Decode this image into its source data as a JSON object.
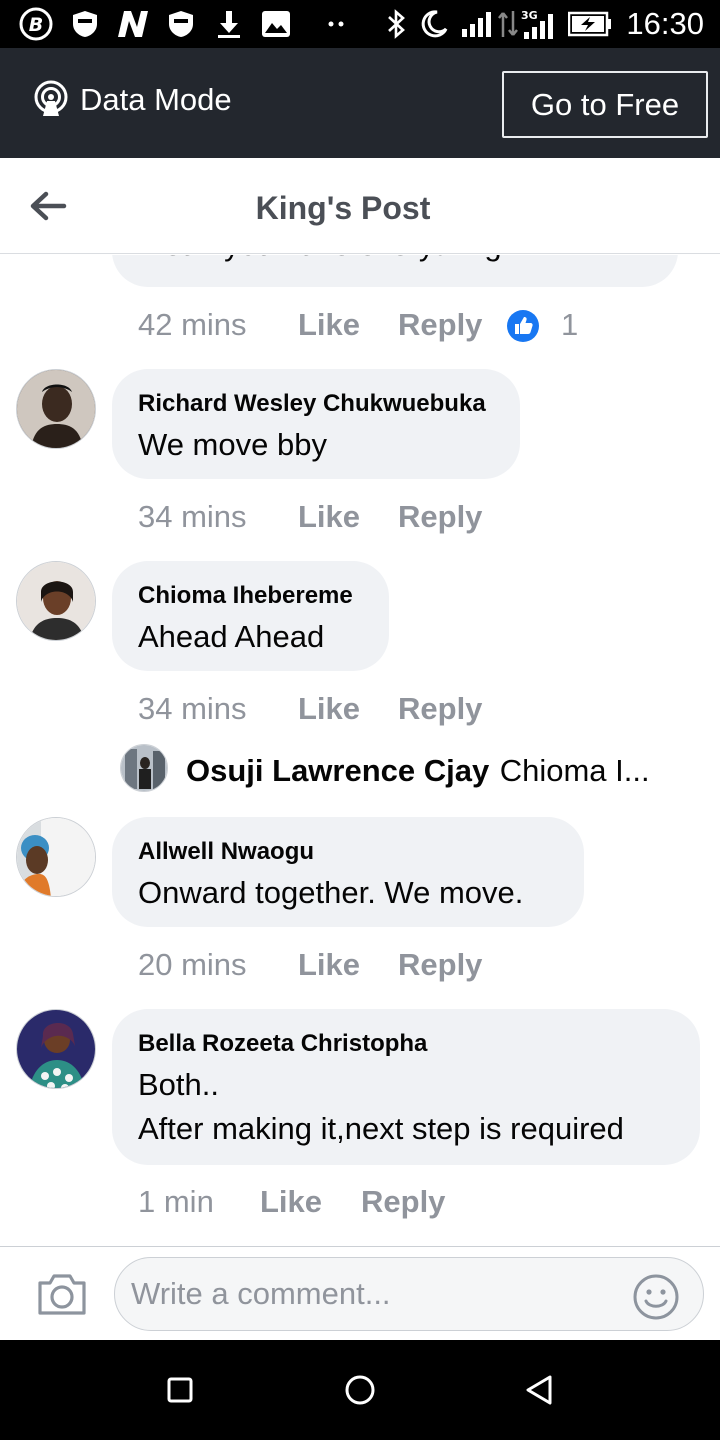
{
  "status_bar": {
    "time": "16:30",
    "network": "3G",
    "icons": [
      "b-app-icon",
      "shield-icon",
      "n-app-icon",
      "shield-icon",
      "download-icon",
      "image-icon",
      "dots-icon",
      "bluetooth-icon",
      "moon-icon",
      "signal-icon",
      "data-arrows-icon",
      "signal-3g-icon",
      "battery-charging-icon"
    ]
  },
  "data_mode": {
    "label": "Data Mode",
    "button": "Go to Free",
    "icon": "broadcast-icon"
  },
  "header": {
    "title": "King's Post",
    "back_icon": "arrow-left-icon"
  },
  "partial_comment": {
    "text": "mean you have everything.",
    "time": "42 mins",
    "like": "Like",
    "reply": "Reply",
    "reaction_icon": "thumbs-up-icon",
    "reaction_count": "1"
  },
  "comments": [
    {
      "name": "Richard Wesley Chukwuebuka",
      "lines": [
        "We move bby"
      ],
      "time": "34 mins",
      "like": "Like",
      "reply": "Reply"
    },
    {
      "name": "Chioma Ihebereme",
      "lines": [
        "Ahead Ahead"
      ],
      "time": "34 mins",
      "like": "Like",
      "reply": "Reply",
      "reply_preview": {
        "name": "Osuji Lawrence Cjay",
        "text": "Chioma I..."
      }
    },
    {
      "name": "Allwell Nwaogu",
      "lines": [
        "Onward together. We move."
      ],
      "time": "20 mins",
      "like": "Like",
      "reply": "Reply"
    },
    {
      "name": "Bella Rozeeta Christopha",
      "lines": [
        "Both..",
        "After making it,next step is required"
      ],
      "time": "1 min",
      "like": "Like",
      "reply": "Reply"
    }
  ],
  "composer": {
    "placeholder": "Write a comment...",
    "camera_icon": "camera-icon",
    "emoji_icon": "emoji-icon"
  },
  "nav_bar": {
    "icons": [
      "recents-square-icon",
      "home-circle-icon",
      "back-triangle-icon"
    ]
  },
  "colors": {
    "status_bar": "#000000",
    "data_bar": "#23272e",
    "bubble": "#f0f2f5",
    "meta_text": "#90949c",
    "like_blue": "#1877f2"
  }
}
